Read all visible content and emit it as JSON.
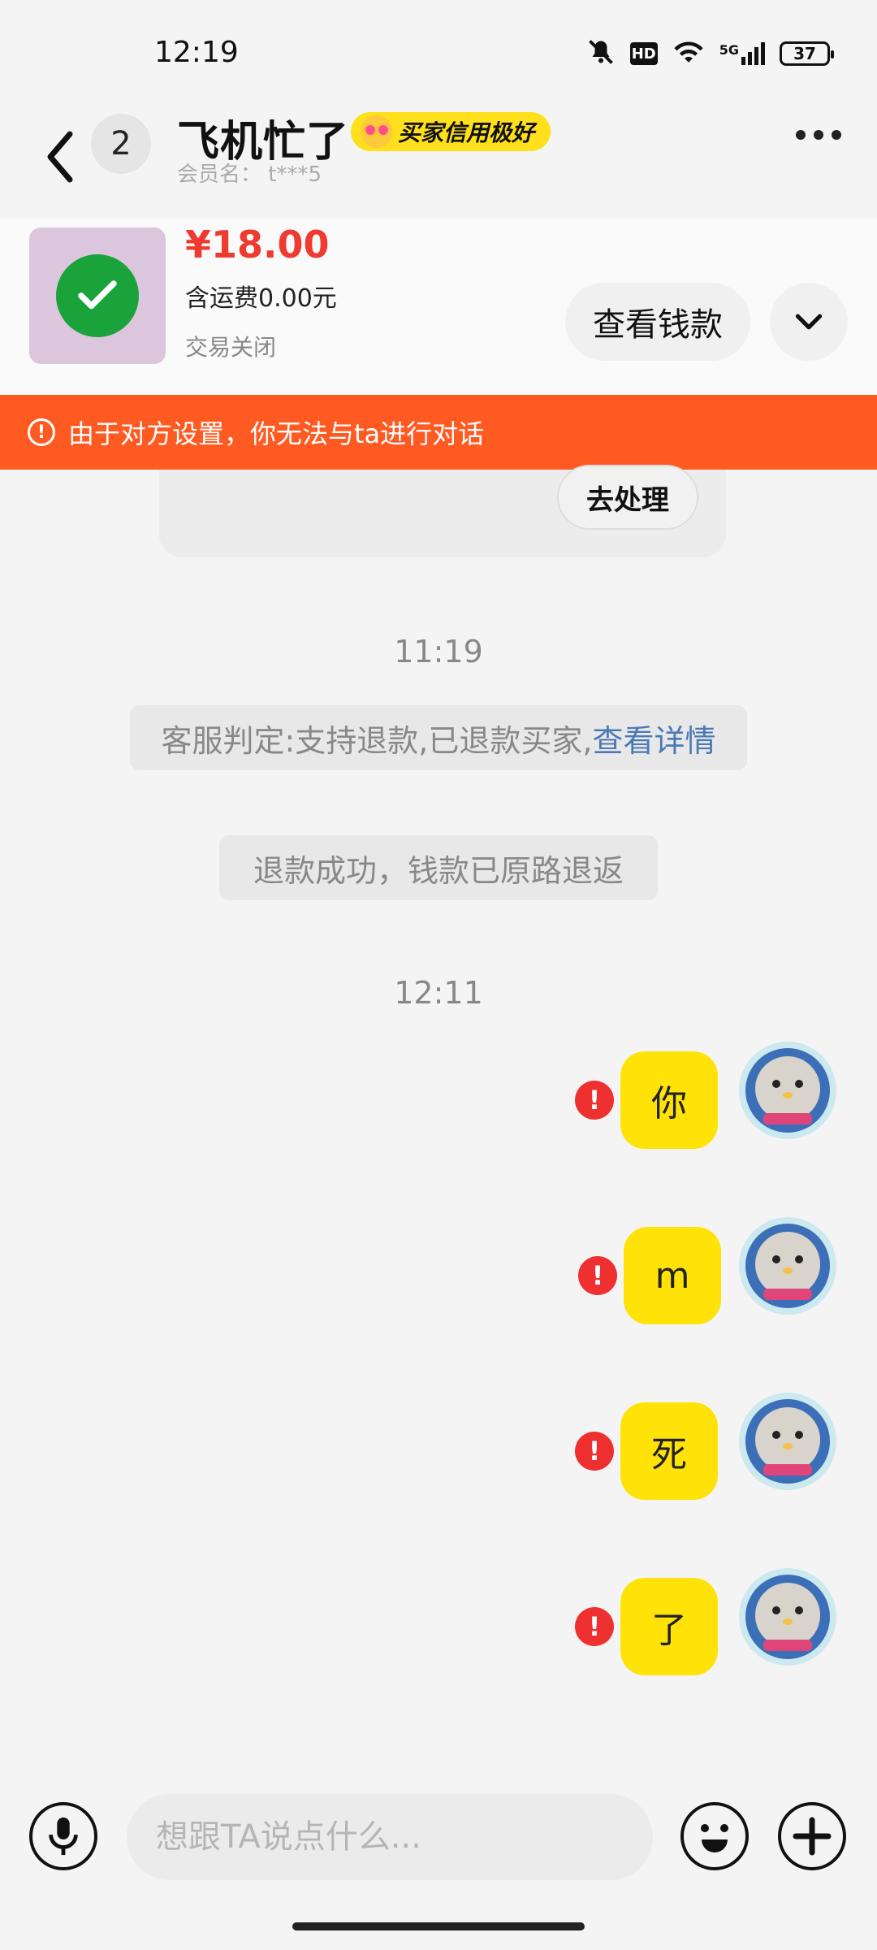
{
  "status_bar": {
    "time": "12:19",
    "network": "5G",
    "hd": "HD",
    "battery": "37"
  },
  "header": {
    "unread_count": "2",
    "name": "飞机忙了",
    "credit_label": "买家信用极好",
    "member": "会员名：  t***5"
  },
  "product": {
    "price": "¥18.00",
    "shipping": "含运费0.00元",
    "status": "交易关闭",
    "view_money_label": "查看钱款"
  },
  "banner": {
    "text": "由于对方设置，你无法与ta进行对话"
  },
  "partial_card": {
    "action_label": "去处理"
  },
  "messages": {
    "time1": "11:19",
    "sys1_text": "客服判定:支持退款,已退款买家,",
    "sys1_link": "查看详情",
    "sys2_text": "退款成功，钱款已原路退返",
    "time2": "12:11",
    "bubbles": [
      "你",
      "m",
      "死",
      "了"
    ]
  },
  "input": {
    "placeholder": "想跟TA说点什么..."
  },
  "colors": {
    "accent_orange": "#ff5a22",
    "price_red": "#ee3a2f",
    "bubble_yellow": "#ffe308",
    "link_blue": "#4a79b6",
    "error_red": "#ee3030"
  }
}
